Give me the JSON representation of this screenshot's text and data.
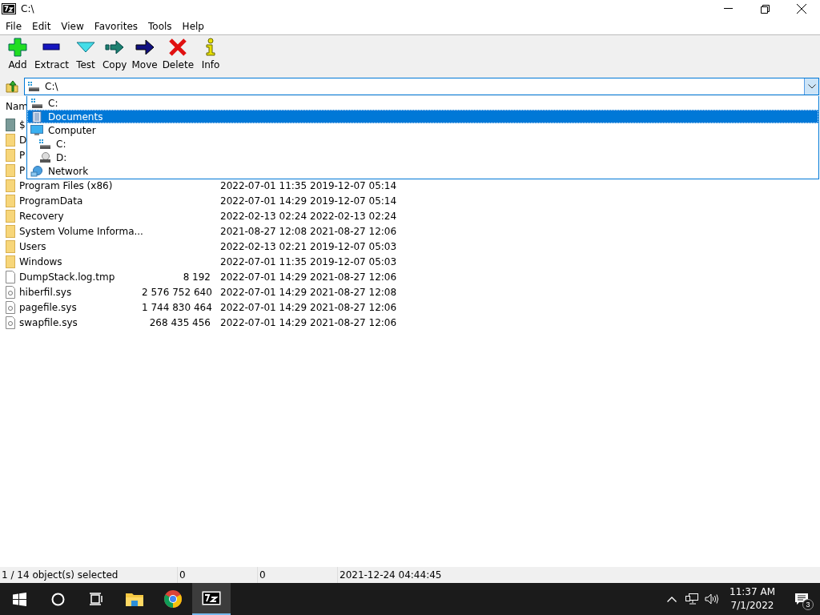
{
  "window": {
    "title": "C:\\"
  },
  "menu": [
    "File",
    "Edit",
    "View",
    "Favorites",
    "Tools",
    "Help"
  ],
  "toolbar": [
    {
      "kind": "add",
      "label": "Add"
    },
    {
      "kind": "extract",
      "label": "Extract"
    },
    {
      "kind": "test",
      "label": "Test"
    },
    {
      "kind": "copy",
      "label": "Copy"
    },
    {
      "kind": "move",
      "label": "Move"
    },
    {
      "kind": "delete",
      "label": "Delete"
    },
    {
      "kind": "info",
      "label": "Info"
    }
  ],
  "address": {
    "value": "C:\\",
    "expanded": true
  },
  "dropdown": [
    {
      "kind": "drive",
      "label": "C:",
      "selected": false
    },
    {
      "kind": "documents",
      "label": "Documents",
      "selected": true
    },
    {
      "kind": "computer",
      "label": "Computer",
      "selected": false,
      "children": [
        {
          "kind": "drive",
          "label": "C:",
          "selected": false
        },
        {
          "kind": "cdrom",
          "label": "D:",
          "selected": false
        }
      ]
    },
    {
      "kind": "network",
      "label": "Network",
      "selected": false
    }
  ],
  "table": {
    "columns": [
      "Nam"
    ],
    "rows": [
      {
        "kind": "recycle",
        "name": "$"
      },
      {
        "kind": "folder",
        "name": "D"
      },
      {
        "kind": "folder",
        "name": "P"
      },
      {
        "kind": "folder",
        "name": "P"
      },
      {
        "kind": "folder",
        "name": "Program Files (x86)",
        "size": "",
        "modified": "2022-07-01 11:35",
        "created": "2019-12-07 05:14"
      },
      {
        "kind": "folder",
        "name": "ProgramData",
        "size": "",
        "modified": "2022-07-01 14:29",
        "created": "2019-12-07 05:14"
      },
      {
        "kind": "folder",
        "name": "Recovery",
        "size": "",
        "modified": "2022-02-13 02:24",
        "created": "2022-02-13 02:24"
      },
      {
        "kind": "folder",
        "name": "System Volume Informa...",
        "size": "",
        "modified": "2021-08-27 12:08",
        "created": "2021-08-27 12:06"
      },
      {
        "kind": "folder",
        "name": "Users",
        "size": "",
        "modified": "2022-02-13 02:21",
        "created": "2019-12-07 05:03"
      },
      {
        "kind": "folder",
        "name": "Windows",
        "size": "",
        "modified": "2022-07-01 11:35",
        "created": "2019-12-07 05:03"
      },
      {
        "kind": "file",
        "name": "DumpStack.log.tmp",
        "size": "8 192",
        "modified": "2022-07-01 14:29",
        "created": "2021-08-27 12:06"
      },
      {
        "kind": "sysfile",
        "name": "hiberfil.sys",
        "size": "2 576 752 640",
        "modified": "2022-07-01 14:29",
        "created": "2021-08-27 12:08"
      },
      {
        "kind": "sysfile",
        "name": "pagefile.sys",
        "size": "1 744 830 464",
        "modified": "2022-07-01 14:29",
        "created": "2021-08-27 12:06"
      },
      {
        "kind": "sysfile",
        "name": "swapfile.sys",
        "size": "268 435 456",
        "modified": "2022-07-01 14:29",
        "created": "2021-08-27 12:06"
      }
    ]
  },
  "status_bar": [
    "1 / 14 object(s) selected",
    "0",
    "0",
    "2021-12-24 04:44:45"
  ],
  "taskbar": {
    "apps": [
      {
        "kind": "explorer",
        "selected": false
      },
      {
        "kind": "chrome",
        "selected": false
      },
      {
        "kind": "sevenzip",
        "selected": true
      }
    ],
    "time": "11:37 AM",
    "date": "7/1/2022",
    "notifications": "3"
  }
}
